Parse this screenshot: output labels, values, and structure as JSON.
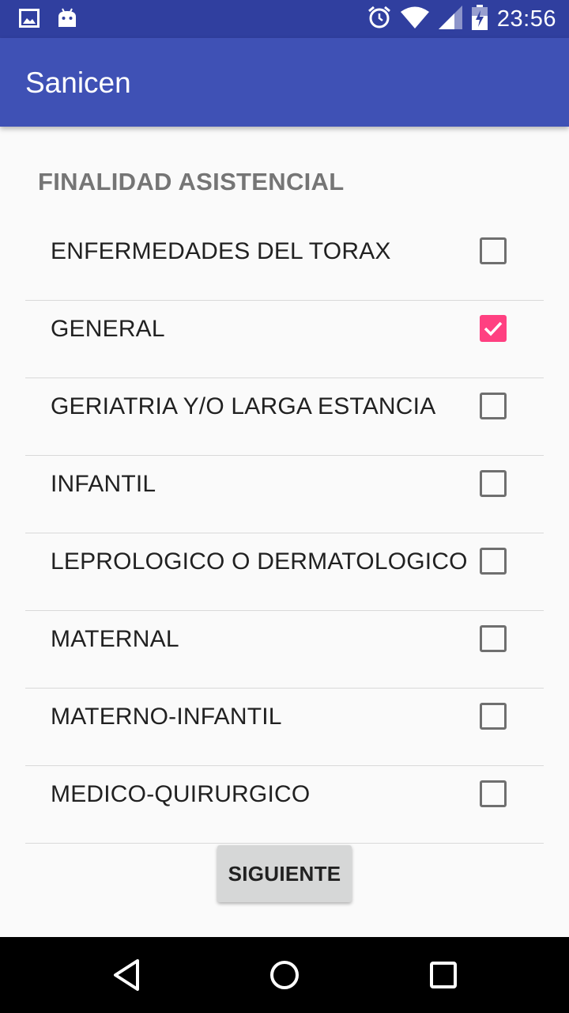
{
  "status_bar": {
    "time": "23:56",
    "icons": [
      "image-icon",
      "android-icon",
      "alarm-icon",
      "wifi-icon",
      "signal-icon",
      "battery-charging-icon"
    ]
  },
  "app_bar": {
    "title": "Sanicen"
  },
  "section": {
    "title": "FINALIDAD ASISTENCIAL",
    "items": [
      {
        "label": "ENFERMEDADES DEL TORAX",
        "checked": false
      },
      {
        "label": "GENERAL",
        "checked": true
      },
      {
        "label": "GERIATRIA Y/O LARGA ESTANCIA",
        "checked": false
      },
      {
        "label": "INFANTIL",
        "checked": false
      },
      {
        "label": "LEPROLOGICO O DERMATOLOGICO",
        "checked": false
      },
      {
        "label": "MATERNAL",
        "checked": false
      },
      {
        "label": "MATERNO-INFANTIL",
        "checked": false
      },
      {
        "label": "MEDICO-QUIRURGICO",
        "checked": false
      }
    ]
  },
  "next_button": {
    "label": "SIGUIENTE"
  },
  "nav_bar": {
    "icons": [
      "back-icon",
      "home-icon",
      "recents-icon"
    ]
  },
  "colors": {
    "status_bar": "#303f9f",
    "app_bar": "#3f51b5",
    "accent": "#ff4081"
  }
}
